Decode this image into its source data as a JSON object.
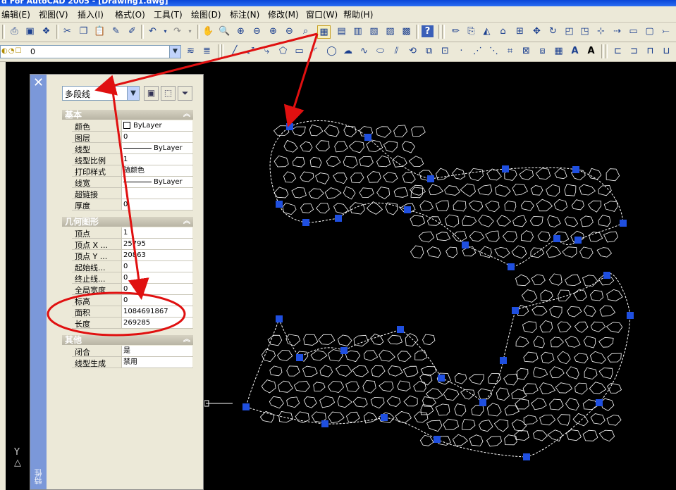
{
  "title_bar": {
    "text": "d For AutoCAD 2005 - [Drawing1.dwg]"
  },
  "menu": {
    "items": [
      "编辑(E)",
      "视图(V)",
      "插入(I)",
      "格式(O)",
      "工具(T)",
      "绘图(D)",
      "标注(N)",
      "修改(M)",
      "窗口(W)",
      "帮助(H)"
    ]
  },
  "layer_toolbar": {
    "current_layer": "0"
  },
  "properties": {
    "title": "特性",
    "object_type": "多段线",
    "general": {
      "header": "基本",
      "rows": [
        {
          "name": "颜色",
          "value": "ByLayer"
        },
        {
          "name": "图层",
          "value": "0"
        },
        {
          "name": "线型",
          "value": "ByLayer"
        },
        {
          "name": "线型比例",
          "value": "1"
        },
        {
          "name": "打印样式",
          "value": "随颜色"
        },
        {
          "name": "线宽",
          "value": "ByLayer"
        },
        {
          "name": "超链接",
          "value": ""
        },
        {
          "name": "厚度",
          "value": "0"
        }
      ]
    },
    "geometry": {
      "header": "几何图形",
      "rows": [
        {
          "name": "顶点",
          "value": "1"
        },
        {
          "name": "顶点 X ...",
          "value": "25795"
        },
        {
          "name": "顶点 Y ...",
          "value": "20863"
        },
        {
          "name": "起始线...",
          "value": "0"
        },
        {
          "name": "终止线...",
          "value": "0"
        },
        {
          "name": "全局宽度",
          "value": "0"
        },
        {
          "name": "标高",
          "value": "0"
        },
        {
          "name": "面积",
          "value": "1084691867"
        },
        {
          "name": "长度",
          "value": "269285"
        }
      ]
    },
    "misc": {
      "header": "其他",
      "rows": [
        {
          "name": "闭合",
          "value": "是"
        },
        {
          "name": "线型生成",
          "value": "禁用"
        }
      ]
    }
  },
  "ucs": {
    "y_label": "Y"
  },
  "colors": {
    "annotation_red": "#e01010",
    "grip_blue": "#1f4fe0",
    "palette_strip": "#7b98d9"
  }
}
